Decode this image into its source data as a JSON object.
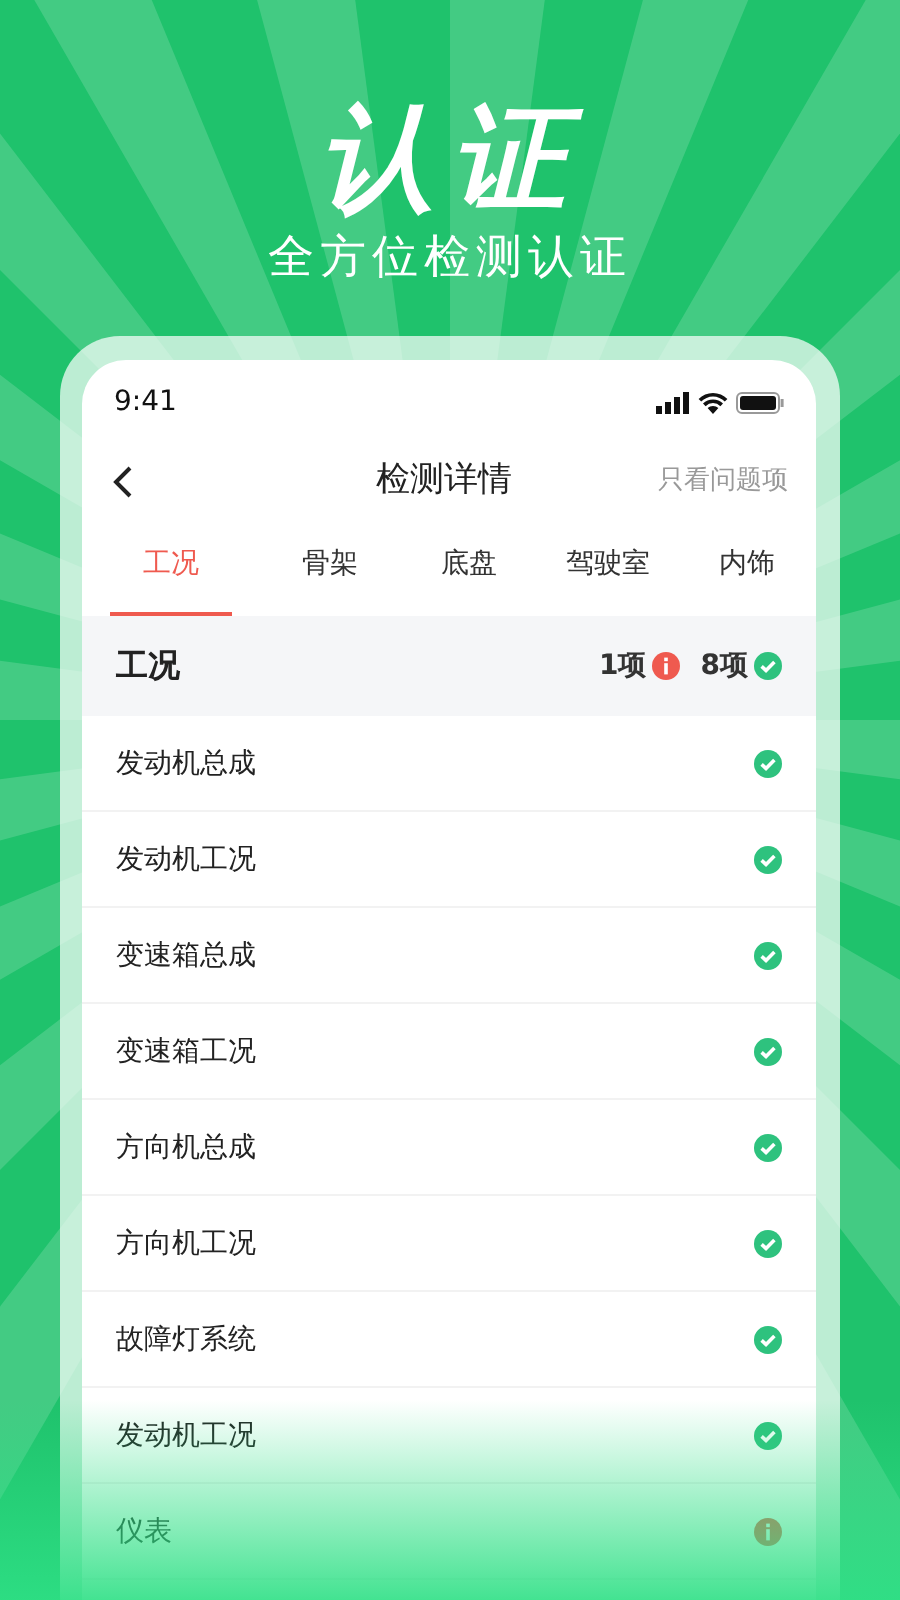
{
  "headline": "认证",
  "subheadline": "全方位检测认证",
  "status_bar": {
    "time": "9:41"
  },
  "nav": {
    "title": "检测详情",
    "filter_link": "只看问题项"
  },
  "tabs": [
    {
      "label": "工况",
      "selected": true
    },
    {
      "label": "骨架",
      "selected": false
    },
    {
      "label": "底盘",
      "selected": false
    },
    {
      "label": "驾驶室",
      "selected": false
    },
    {
      "label": "内饰",
      "selected": false
    }
  ],
  "section": {
    "title": "工况",
    "issue_count": "1项",
    "ok_count": "8项"
  },
  "items": [
    {
      "label": "发动机总成",
      "kind": "ok"
    },
    {
      "label": "发动机工况",
      "kind": "ok"
    },
    {
      "label": "变速箱总成",
      "kind": "ok"
    },
    {
      "label": "变速箱工况",
      "kind": "ok"
    },
    {
      "label": "方向机总成",
      "kind": "ok"
    },
    {
      "label": "方向机工况",
      "kind": "ok"
    },
    {
      "label": "故障灯系统",
      "kind": "ok"
    },
    {
      "label": "发动机工况",
      "kind": "ok"
    },
    {
      "label": "仪表",
      "kind": "issue"
    }
  ]
}
